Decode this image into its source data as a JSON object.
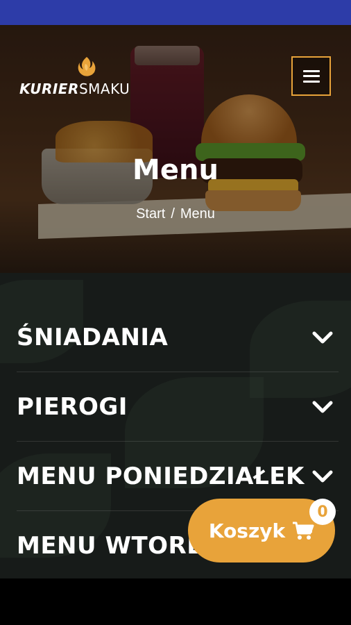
{
  "app": {
    "logo_bold": "KURIER",
    "logo_light": "SMAKU",
    "accent_color": "#e8a33a",
    "status_bar_color": "#2d3ca8"
  },
  "header": {
    "menu_icon": "hamburger-icon"
  },
  "hero": {
    "title": "Menu",
    "breadcrumb": {
      "home": "Start",
      "separator": "/",
      "current": "Menu"
    }
  },
  "categories": [
    {
      "label": "ŚNIADANIA",
      "icon": "chevron-down-icon"
    },
    {
      "label": "PIEROGI",
      "icon": "chevron-down-icon"
    },
    {
      "label": "MENU PONIEDZIAŁEK",
      "icon": "chevron-down-icon"
    },
    {
      "label": "MENU WTOREK",
      "icon": "chevron-down-icon"
    }
  ],
  "cart": {
    "label": "Koszyk",
    "count": "0",
    "icon": "cart-icon"
  }
}
